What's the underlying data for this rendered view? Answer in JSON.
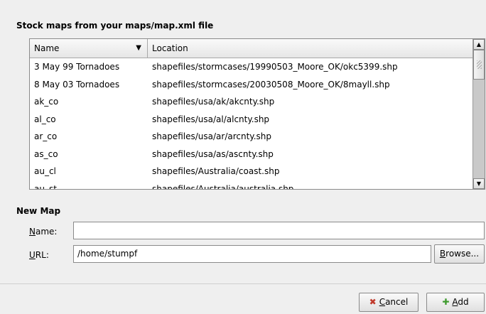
{
  "stock_section": {
    "title": "Stock maps from your maps/map.xml file",
    "columns": {
      "name": "Name",
      "location": "Location"
    },
    "rows": [
      {
        "name": "3 May 99 Tornadoes",
        "location": "shapefiles/stormcases/19990503_Moore_OK/okc5399.shp"
      },
      {
        "name": "8 May 03 Tornadoes",
        "location": "shapefiles/stormcases/20030508_Moore_OK/8mayll.shp"
      },
      {
        "name": "ak_co",
        "location": "shapefiles/usa/ak/akcnty.shp"
      },
      {
        "name": "al_co",
        "location": "shapefiles/usa/al/alcnty.shp"
      },
      {
        "name": "ar_co",
        "location": "shapefiles/usa/ar/arcnty.shp"
      },
      {
        "name": "as_co",
        "location": "shapefiles/usa/as/ascnty.shp"
      },
      {
        "name": "au_cl",
        "location": "shapefiles/Australia/coast.shp"
      },
      {
        "name": "au_st",
        "location": "shapefiles/Australia/australia.shp"
      }
    ]
  },
  "new_map": {
    "title": "New Map",
    "name_label_mnemonic": "N",
    "name_label_rest": "ame:",
    "name_value": "",
    "url_label_mnemonic": "U",
    "url_label_rest": "RL:",
    "url_value": "/home/stumpf",
    "browse_mnemonic": "B",
    "browse_rest": "rowse..."
  },
  "buttons": {
    "cancel_mnemonic": "C",
    "cancel_rest": "ancel",
    "add_mnemonic": "A",
    "add_rest": "dd"
  },
  "icons": {
    "sort": "chevron-down-icon",
    "scroll_up": "arrow-up-icon",
    "scroll_down": "arrow-down-icon",
    "cancel": "x-icon",
    "add": "plus-icon"
  }
}
